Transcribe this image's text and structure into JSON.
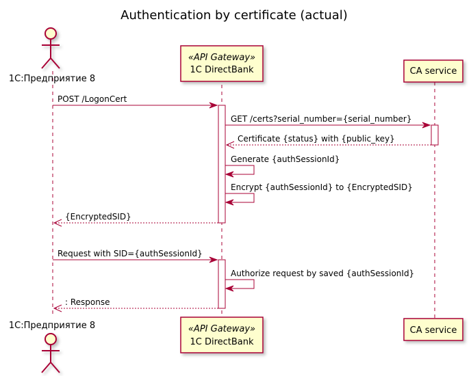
{
  "diagram": {
    "title": "Authentication by certificate (actual)",
    "participants": {
      "client": {
        "label": "1С:Предприятие 8",
        "kind": "actor"
      },
      "gateway": {
        "stereotype": "«API Gateway»",
        "label": "1C DirectBank",
        "kind": "participant"
      },
      "ca": {
        "label": "CA service",
        "kind": "participant"
      }
    },
    "messages": [
      {
        "from": "client",
        "to": "gateway",
        "label": "POST /LogonCert",
        "style": "solid"
      },
      {
        "from": "gateway",
        "to": "ca",
        "label": "GET /certs?serial_number={serial_number}",
        "style": "solid"
      },
      {
        "from": "ca",
        "to": "gateway",
        "label": "Certificate {status} with {public_key}",
        "style": "dashed"
      },
      {
        "from": "gateway",
        "to": "gateway",
        "label": "Generate {authSessionId}",
        "style": "self"
      },
      {
        "from": "gateway",
        "to": "gateway",
        "label": "Encrypt {authSessionId} to {EncryptedSID}",
        "style": "self"
      },
      {
        "from": "gateway",
        "to": "client",
        "label": "{EncryptedSID}",
        "style": "dashed"
      },
      {
        "from": "client",
        "to": "gateway",
        "label": "Request with SID={authSessionId}",
        "style": "solid"
      },
      {
        "from": "gateway",
        "to": "gateway",
        "label": "Authorize request by saved {authSessionId}",
        "style": "self"
      },
      {
        "from": "gateway",
        "to": "client",
        "label": ": Response",
        "style": "dashed"
      }
    ],
    "colors": {
      "line": "#a80036",
      "participant_fill": "#fefece",
      "background": "#ffffff"
    }
  }
}
